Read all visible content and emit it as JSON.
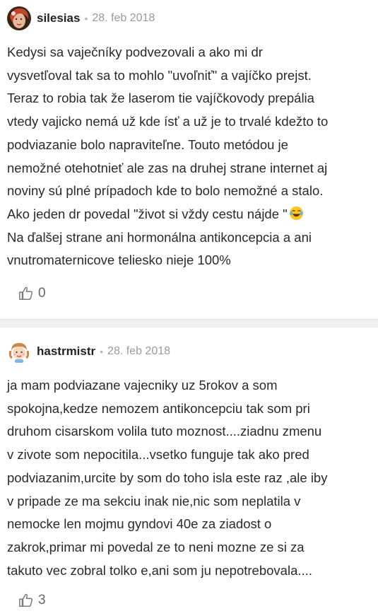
{
  "comments": [
    {
      "username": "silesias",
      "separator": "•",
      "date": "28. feb 2018",
      "lines": [
        "Kedysi sa vaječníky podvezovali a ako mi dr",
        "vysvetľoval tak sa to mohlo \"uvoľniť\" a vajíčko prejst.",
        "Teraz to robia tak že laserom tie vajíčkovody prepália",
        "vtedy vajicko nemá už kde ísť a už je to trvalé kdežto to",
        "podviazanie bolo napraviteľne. Touto metódou je",
        "nemožné otehotnieť ale zas na druhej strane internet aj",
        "noviny sú plné prípadoch kde to bolo nemožné a stalo.",
        "Ako jeden dr povedal \"život si vždy cestu nájde \"",
        "Na ďalšej strane ani hormonálna antikoncepcia a ani",
        "vnutromaternicove teliesko nieje 100%"
      ],
      "emoji": "laughing-tears-emoji",
      "likes": "0"
    },
    {
      "username": "hastrmistr",
      "separator": "•",
      "date": "28. feb 2018",
      "lines": [
        "ja mam podviazane vajecniky uz 5rokov a som",
        "spokojna,kedze nemozem antikoncepciu tak som pri",
        "druhom cisarskom volila tuto moznost....ziadnu zmenu",
        "v zivote som nepocitila...vsetko funguje tak ako pred",
        "podviazanim,urcite by som do toho isla este raz ,ale iby",
        "v pripade ze ma sekciu inak nie,nic som neplatila v",
        "nemocke len mojmu gyndovi 40e za ziadost o",
        "zakrok,primar mi povedal ze to neni mozne ze si za",
        "takuto vec zobral tolko e,ani som ju nepotrebovala...."
      ],
      "likes": "3"
    }
  ],
  "icons": {
    "like": "thumbs-up-icon"
  },
  "colors": {
    "divider": "#f1f1f1",
    "meta": "#9a9a9a",
    "like_icon": "#7a7a7a"
  }
}
